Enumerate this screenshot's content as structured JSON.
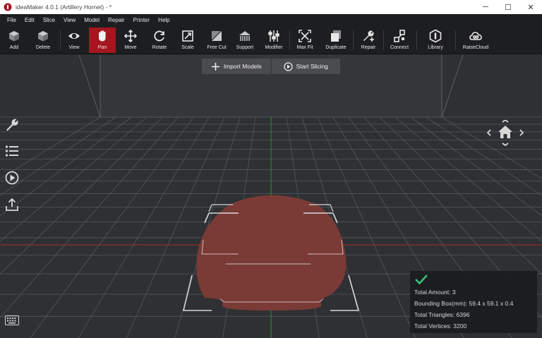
{
  "window": {
    "title": "ideaMaker 4.0.1 (Artillery Hornet) - *",
    "minimize": "─",
    "maximize": "☐",
    "close": "✕"
  },
  "menu": [
    "File",
    "Edit",
    "Slice",
    "View",
    "Model",
    "Repair",
    "Printer",
    "Help"
  ],
  "toolbar": [
    {
      "label": "Add",
      "icon": "add-cube-icon"
    },
    {
      "label": "Delete",
      "icon": "delete-cube-icon"
    },
    {
      "label": "View",
      "icon": "eye-icon"
    },
    {
      "label": "Pan",
      "icon": "hand-icon",
      "active": true
    },
    {
      "label": "Move",
      "icon": "move-arrows-icon"
    },
    {
      "label": "Rotate",
      "icon": "rotate-icon"
    },
    {
      "label": "Scale",
      "icon": "scale-icon"
    },
    {
      "label": "Free Cut",
      "icon": "cut-icon"
    },
    {
      "label": "Support",
      "icon": "support-icon"
    },
    {
      "label": "Modifier",
      "icon": "modifier-sliders-icon"
    },
    {
      "label": "Max Fit",
      "icon": "max-fit-icon"
    },
    {
      "label": "Duplicate",
      "icon": "duplicate-icon"
    },
    {
      "label": "Repair",
      "icon": "wrench-icon"
    },
    {
      "label": "Connect",
      "icon": "connect-icon"
    },
    {
      "label": "Library",
      "icon": "library-icon"
    },
    {
      "label": "RaiseCloud",
      "icon": "cloud-icon"
    }
  ],
  "actions": {
    "import_label": "Import Models",
    "slice_label": "Start Slicing"
  },
  "side_tools": [
    "wrench-icon",
    "list-icon",
    "play-icon",
    "upload-icon"
  ],
  "info": {
    "total_amount": "Total Amount: 3",
    "bounding_box": "Bounding Box(mm): 59.4 x 59.1 x 0.4",
    "total_triangles": "Total Triangles: 6396",
    "total_vertices": "Total Vertices: 3200"
  },
  "colors": {
    "accent": "#a5161f",
    "model": "#7a3a36",
    "check": "#3cc07a",
    "grid": "#5c5f63",
    "axis_x": "#a8322a",
    "axis_y": "#2f8f3b"
  }
}
